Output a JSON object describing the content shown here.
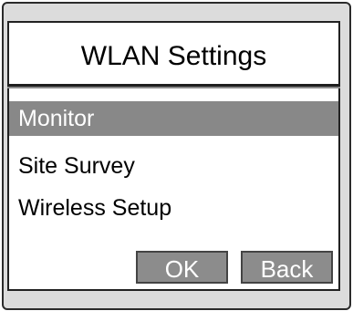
{
  "dialog": {
    "title": "WLAN Settings"
  },
  "menu": {
    "items": [
      {
        "label": "Monitor",
        "selected": true
      },
      {
        "label": "Site Survey",
        "selected": false
      },
      {
        "label": "Wireless Setup",
        "selected": false
      }
    ]
  },
  "buttons": {
    "ok_label": "OK",
    "back_label": "Back"
  },
  "colors": {
    "panel_bg": "#dcdcdc",
    "selection": "#888888",
    "button_bg": "#8c8c8c"
  }
}
